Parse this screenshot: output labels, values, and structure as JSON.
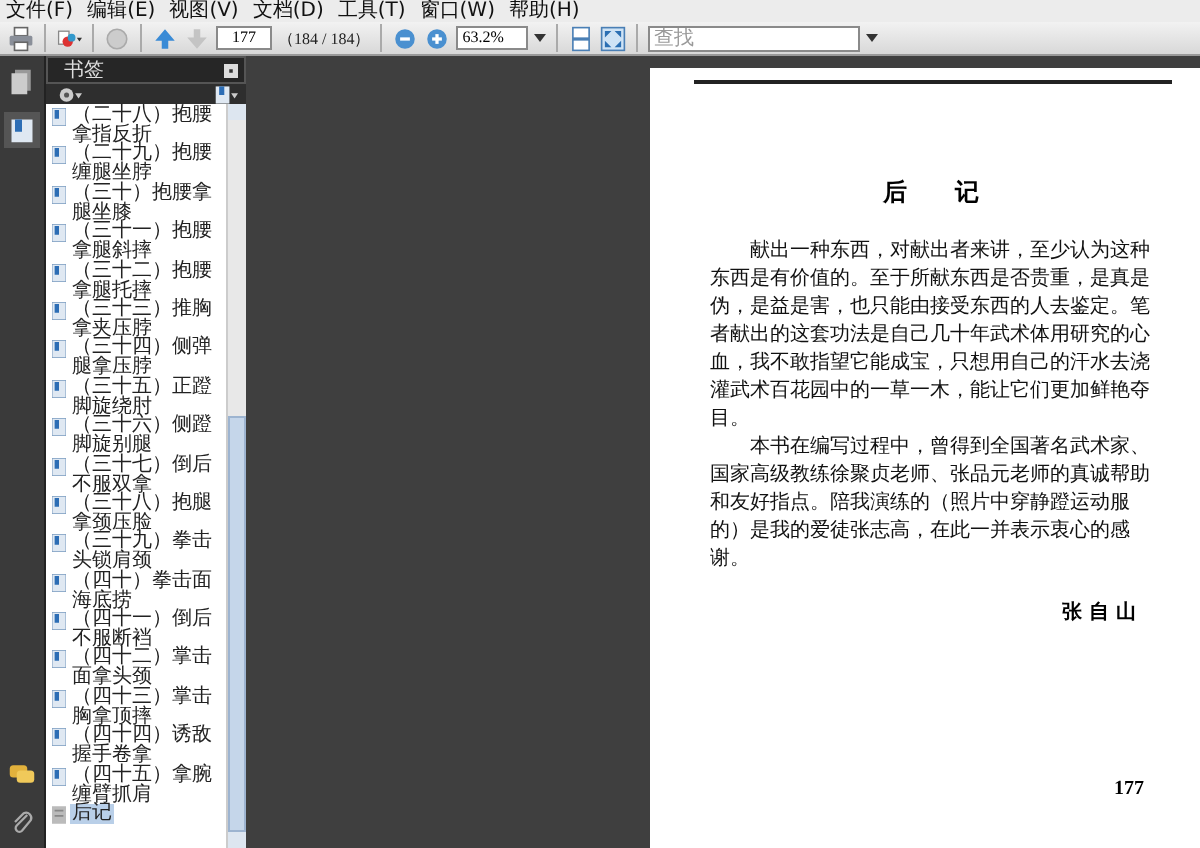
{
  "menu": [
    "文件(F)",
    "编辑(E)",
    "视图(V)",
    "文档(D)",
    "工具(T)",
    "窗口(W)",
    "帮助(H)"
  ],
  "toolbar": {
    "page_number": "177",
    "page_count": "（184 / 184）",
    "zoom": "63.2%",
    "search": {
      "placeholder": "查找"
    }
  },
  "bookmarks_panel": {
    "title": "书签",
    "items": [
      {
        "label": "（二十八）抱腰拿指反折",
        "kind": "section",
        "selected": false
      },
      {
        "label": "（二十九）抱腰缠腿坐脖",
        "kind": "section",
        "selected": false
      },
      {
        "label": "（三十）抱腰拿腿坐膝",
        "kind": "section",
        "selected": false
      },
      {
        "label": "（三十一）抱腰拿腿斜摔",
        "kind": "section",
        "selected": false
      },
      {
        "label": "（三十二）抱腰拿腿托摔",
        "kind": "section",
        "selected": false
      },
      {
        "label": "（三十三）推胸拿夹压脖",
        "kind": "section",
        "selected": false
      },
      {
        "label": "（三十四）侧弹腿拿压脖",
        "kind": "section",
        "selected": false
      },
      {
        "label": "（三十五）正蹬脚旋绕肘",
        "kind": "section",
        "selected": false
      },
      {
        "label": "（三十六）侧蹬脚旋别腿",
        "kind": "section",
        "selected": false
      },
      {
        "label": "（三十七）倒后不服双拿",
        "kind": "section",
        "selected": false
      },
      {
        "label": "（三十八）抱腿拿颈压脸",
        "kind": "section",
        "selected": false
      },
      {
        "label": "（三十九）拳击头锁肩颈",
        "kind": "section",
        "selected": false
      },
      {
        "label": "（四十）拳击面海底捞",
        "kind": "section",
        "selected": false
      },
      {
        "label": "（四十一）倒后不服断裆",
        "kind": "section",
        "selected": false
      },
      {
        "label": "（四十二）掌击面拿头颈",
        "kind": "section",
        "selected": false
      },
      {
        "label": "（四十三）掌击胸拿顶摔",
        "kind": "section",
        "selected": false
      },
      {
        "label": "（四十四）诱敌握手卷拿",
        "kind": "section",
        "selected": false
      },
      {
        "label": "（四十五）拿腕缠臂抓肩",
        "kind": "section",
        "selected": false
      },
      {
        "label": "后记",
        "kind": "page",
        "selected": true
      }
    ]
  },
  "page": {
    "title": "后　　记",
    "paragraphs": [
      "献出一种东西，对献出者来讲，至少认为这种东西是有价值的。至于所献东西是否贵重，是真是伪，是益是害，也只能由接受东西的人去鉴定。笔者献出的这套功法是自己几十年武术体用研究的心血，我不敢指望它能成宝，只想用自己的汗水去浇灌武术百花园中的一草一木，能让它们更加鲜艳夺目。",
      "本书在编写过程中，曾得到全国著名武术家、国家高级教练徐聚贞老师、张品元老师的真诚帮助和友好指点。陪我演练的（照片中穿静蹬运动服的）是我的爱徒张志高，在此一并表示衷心的感谢。"
    ],
    "signature": "张 自 山",
    "page_number": "177"
  }
}
